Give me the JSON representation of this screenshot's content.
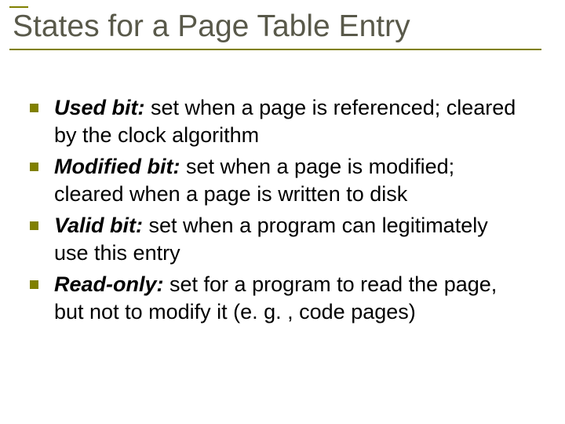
{
  "title": "States for a Page Table Entry",
  "items": [
    {
      "term": "Used bit:",
      "desc": "  set when a page is referenced; cleared by the clock algorithm"
    },
    {
      "term": "Modified bit:",
      "desc": "  set when a page is modified; cleared when a page is written to disk"
    },
    {
      "term": "Valid bit:",
      "desc": "  set when a program can legitimately use this entry"
    },
    {
      "term": "Read-only:",
      "desc": "  set for a program to read the page, but not to modify it (e. g. , code pages)"
    }
  ]
}
